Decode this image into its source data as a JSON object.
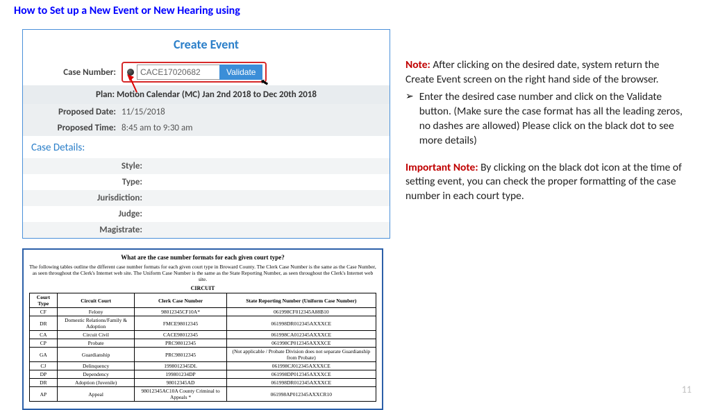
{
  "title": "How to Set up a New Event or New Hearing using",
  "panel": {
    "heading": "Create Event",
    "case_label": "Case Number:",
    "case_value": "CACE17020682",
    "validate_label": "Validate",
    "plan": "Plan: Motion Calendar (MC) Jan 2nd 2018 to Dec 20th 2018",
    "proposed_date_label": "Proposed Date:",
    "proposed_date": "11/15/2018",
    "proposed_time_label": "Proposed Time:",
    "proposed_time": "8:45 am to 9:30 am",
    "details_heading": "Case Details:",
    "detail_labels": {
      "style": "Style:",
      "type": "Type:",
      "jurisdiction": "Jurisdiction:",
      "judge": "Judge:",
      "magistrate": "Magistrate:"
    }
  },
  "formats": {
    "question": "What are the case number formats for each given court type?",
    "intro": "The following tables outline the different case number formats for each given court type in Broward County. The Clerk Case Number is the same as the Case Number, as seen throughout the Clerk's Internet web site. The Uniform Case Number is the same as the State Reporting Number, as seen throughout the Clerk's Internet web site.",
    "circuit_label": "CIRCUIT",
    "headers": [
      "Court Type",
      "Circuit Court",
      "Clerk Case Number",
      "State Reporting Number (Uniform Case Number)"
    ],
    "rows": [
      [
        "CF",
        "Felony",
        "98012345CF10A*",
        "061998CF012345A88B10"
      ],
      [
        "DR",
        "Domestic Relations/Family & Adoption",
        "FMCE98012345",
        "061998DR012345AXXXCE"
      ],
      [
        "CA",
        "Circuit Civil",
        "CACE98012345",
        "061998CA012345AXXXCE"
      ],
      [
        "CP",
        "Probate",
        "PRC98012345",
        "061998CP012345AXXXCE"
      ],
      [
        "GA",
        "Guardianship",
        "PRC98012345",
        "(Not applicable / Probate Division does not separate Guardianship from Probate)"
      ],
      [
        "CJ",
        "Delinquency",
        "1998012345DL",
        "061998CJ012345AXXXCE"
      ],
      [
        "DP",
        "Dependency",
        "199801234DP",
        "061998DP012345AXXXCE"
      ],
      [
        "DR",
        "Adoption (Juvenile)",
        "98012345AD",
        "061998DR012345AXXXCE"
      ],
      [
        "AP",
        "Appeal",
        "98012345AC10A County Criminal to Appeals *",
        "061998AP012345AXXCR10"
      ]
    ]
  },
  "notes": {
    "note_label": "Note:",
    "note_text": " After clicking on the desired date, system return the Create Event screen on the right hand side of the browser.",
    "bullet": "Enter the desired case number and click on the Validate button. (Make sure the case format has all the leading zeros, no dashes are allowed) Please click on the black dot to see more details)",
    "important_label": "Important Note:",
    "important_text": " By clicking on the black dot icon at the time of setting event, you can check the proper formatting of the case number in each court type."
  },
  "page_number": "11"
}
